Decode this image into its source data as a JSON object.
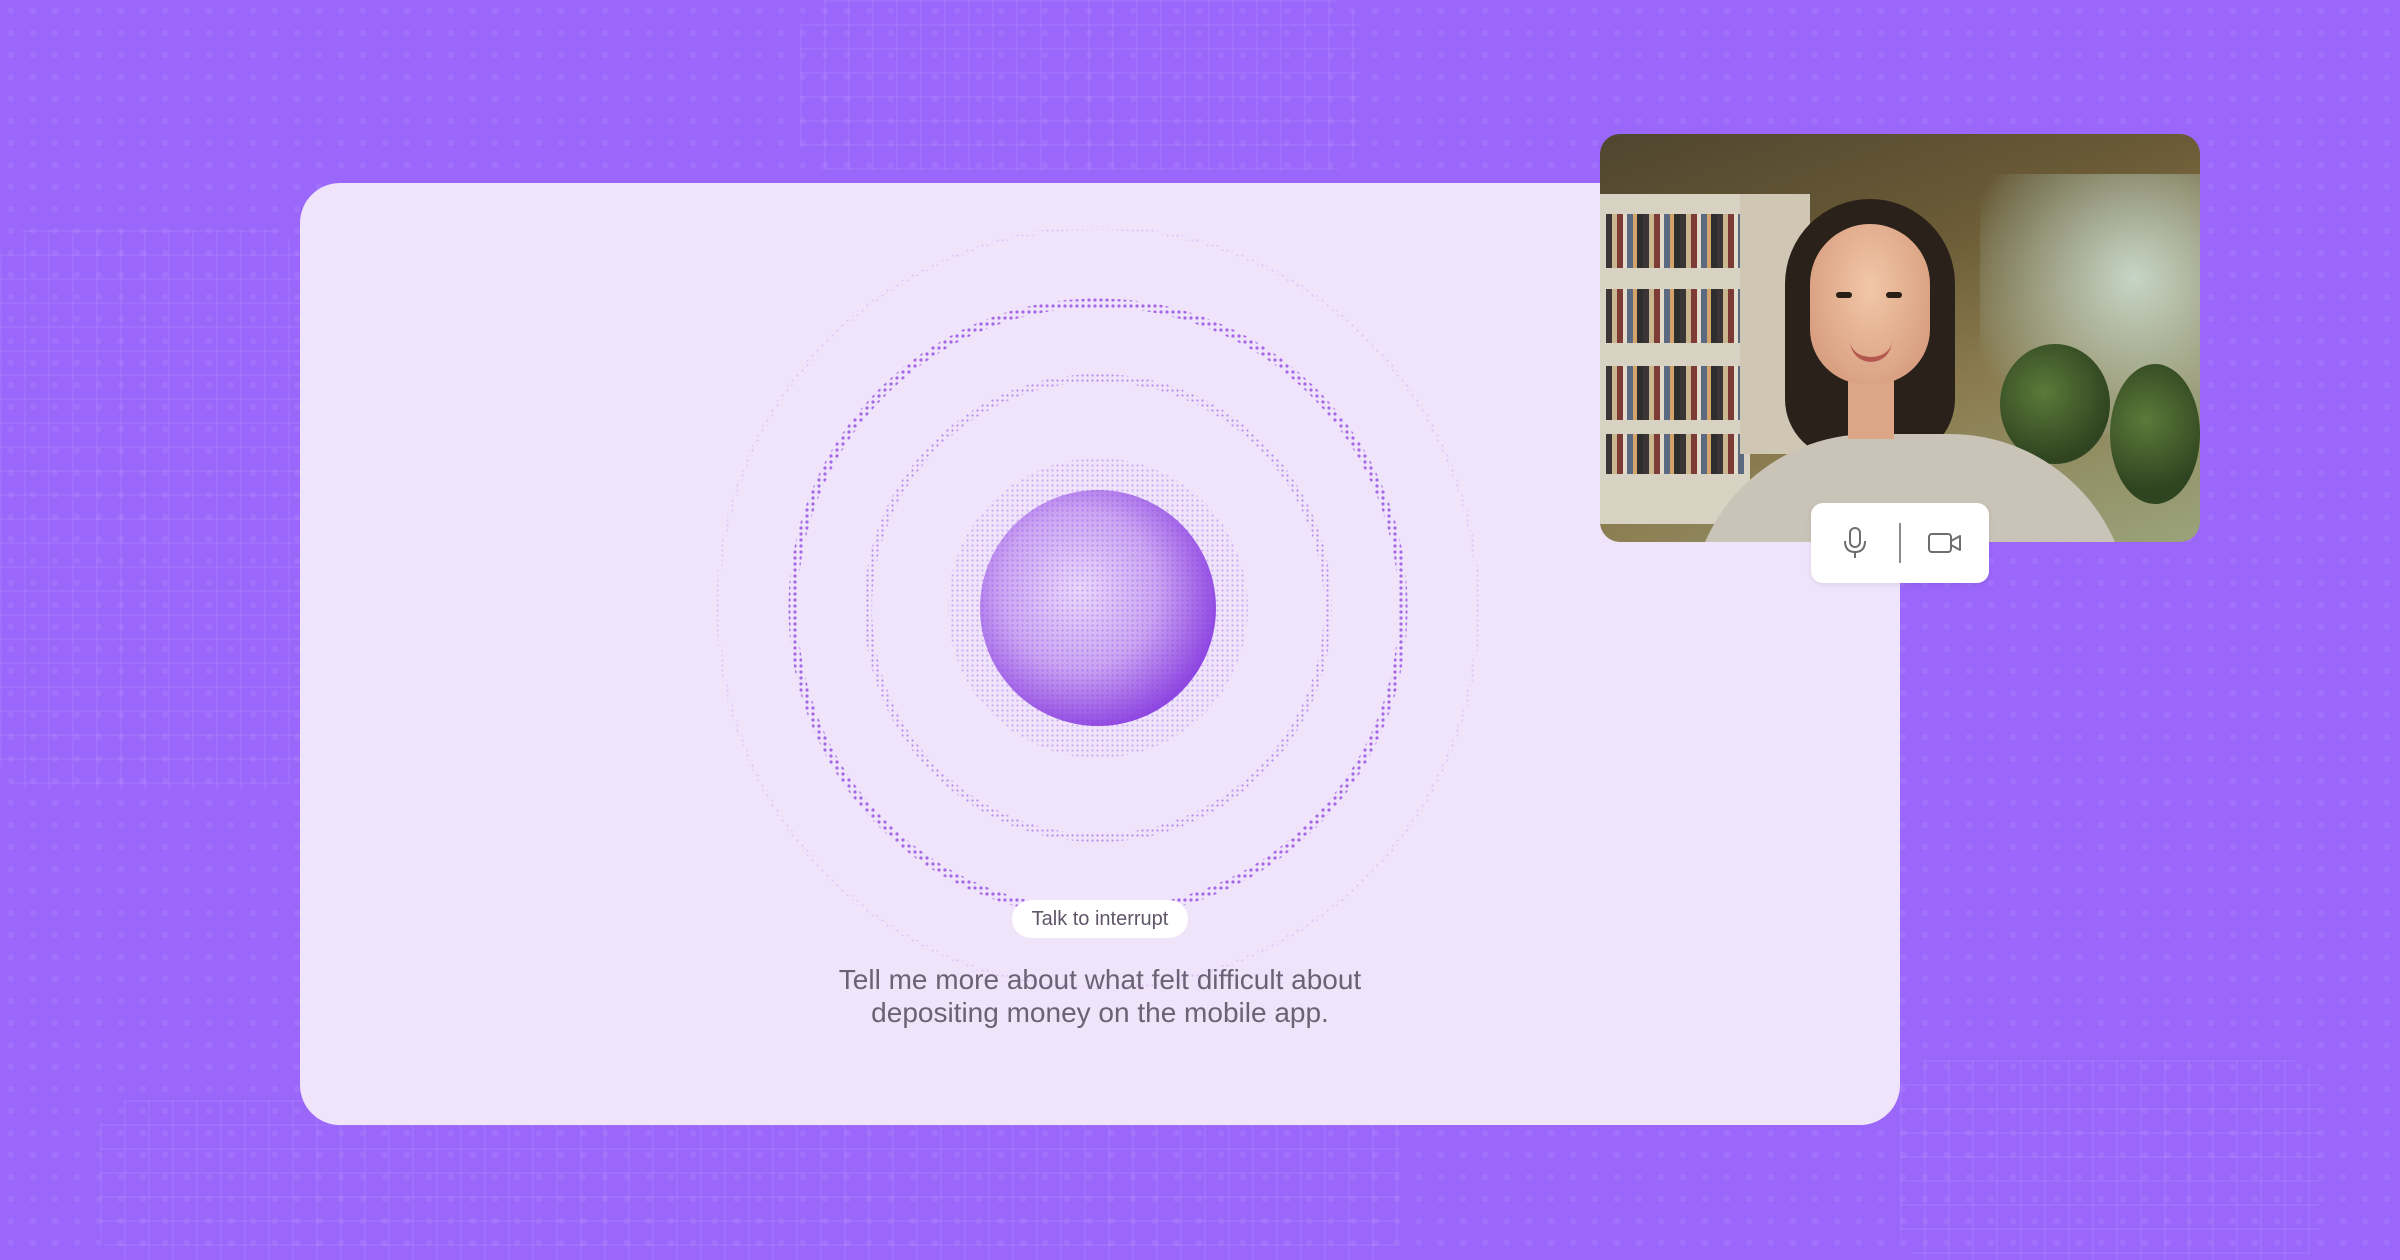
{
  "call": {
    "status_pill": "Talk to interrupt",
    "prompt_line1": "Tell me more about what felt difficult about",
    "prompt_line2": "depositing money on the mobile app."
  },
  "self_view": {
    "controls": [
      {
        "icon": "microphone-icon"
      },
      {
        "icon": "video-camera-icon"
      }
    ]
  },
  "colors": {
    "background": "#9b67fb",
    "card": "#f0e4fb",
    "orb": "#8a3fe0",
    "text": "#6b6275"
  }
}
